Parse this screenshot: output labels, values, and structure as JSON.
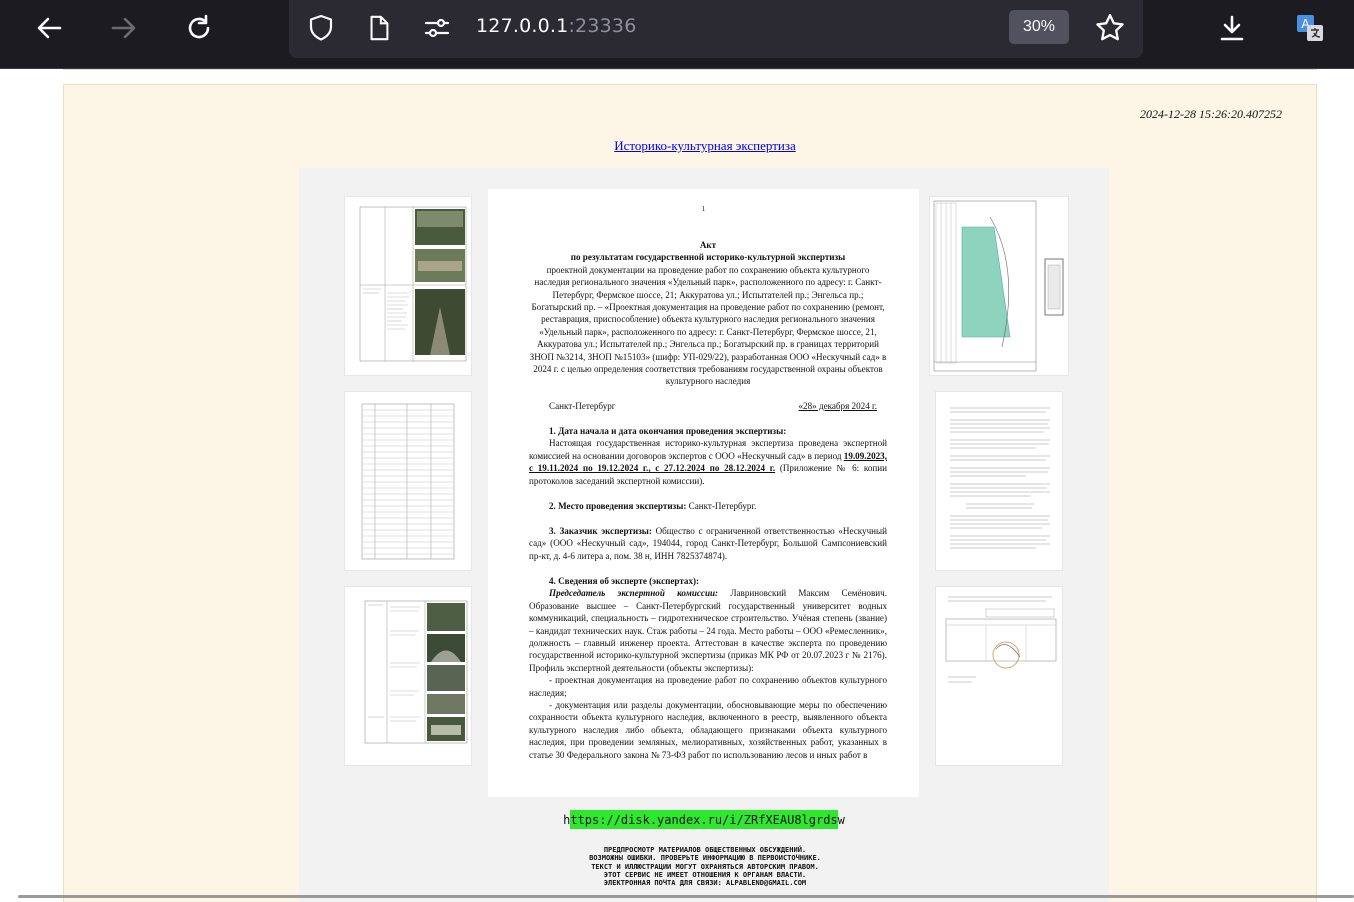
{
  "browser": {
    "url_host": "127.0.0.1",
    "url_port": ":23336",
    "zoom": "30%",
    "icons": [
      "back-arrow-icon",
      "forward-arrow-icon",
      "reload-icon",
      "shield-icon",
      "page-icon",
      "permissions-icon",
      "star-icon",
      "download-icon",
      "translate-icon"
    ]
  },
  "page": {
    "timestamp": "2024-12-28 15:26:20.407252",
    "link_text": "Историко-культурная экспертиза",
    "document": {
      "page_number": "1",
      "title": "Акт",
      "subtitle": "по результатам государственной историко-культурной экспертизы",
      "intro": "проектной документации на проведение работ по сохранению объекта культурного наследия регионального значения «Удельный парк», расположенного по адресу: г. Санкт-Петербург, Фермское шоссе, 21; Аккуратова ул.; Испытателей пр.; Энгельса пр.; Богатырский пр. – «Проектная документация на проведение работ по сохранению (ремонт, реставрация, приспособление) объекта культурного наследия регионального значения «Удельный парк», расположенного по адресу: г. Санкт-Петербург, Фермское шоссе, 21, Аккуратова ул.; Испытателей пр.; Энгельса пр.; Богатырский пр. в границах территорий ЗНОП №3214, ЗНОП №15103» (шифр: УП-029/22), разработанная ООО «Нескучный сад» в 2024 г. с целью определения соответствия требованиям государственной охраны объектов культурного наследия",
      "city": "Санкт-Петербург",
      "date": "«28» декабря 2024 г.",
      "s1_heading": "1. Дата начала и дата окончания проведения экспертизы:",
      "s1_text_a": "Настоящая государственная историко-культурная экспертиза проведена экспертной комиссией на основании договоров экспертов с ООО «Нескучный сад» в период",
      "s1_dates": "19.09.2023, с 19.11.2024 по 19.12.2024 г., с 27.12.2024 по 28.12.2024 г.",
      "s1_text_b": "(Приложение № 6: копии протоколов заседаний экспертной комиссии).",
      "s2_heading": "2. Место проведения экспертизы:",
      "s2_text": "Санкт-Петербург.",
      "s3_heading": "3. Заказчик экспертизы:",
      "s3_text": "Общество с ограниченной ответственностью «Нескучный сад» (ООО «Нескучный сад», 194044, город Санкт-Петербург, Большой Сампсониевский пр-кт, д. 4-6 литера а, пом. 38 н, ИНН 7825374874).",
      "s4_heading": "4. Сведения об эксперте (экспертах):",
      "s4_role": "Председатель экспертной комиссии:",
      "s4_text": "Лавриновский Максим Семёнович. Образование высшее – Санкт-Петербургский государственный университет водных коммуникаций, специальность – гидротехническое строительство. Учёная степень (звание) – кандидат технических наук. Стаж работы – 24 года. Место работы – ООО «Ремесленник», должность – главный инженер проекта. Аттестован в качестве эксперта по проведению государственной историко-культурной экспертизы (приказ МК РФ от 20.07.2023 г № 2176). Профиль экспертной деятельности (объекты экспертизы):",
      "s4_item1": "- проектная документация на проведение работ по сохранению объектов культурного наследия;",
      "s4_item2": "- документация или разделы документации, обосновывающие меры по обеспечению сохранности объекта культурного наследия, включенного в реестр, выявленного объекта культурного наследия либо объекта, обладающего признаками объекта культурного наследия, при проведении земляных, мелиоративных, хозяйственных работ, указанных в статье 30 Федерального закона № 73-ФЗ работ по использованию лесов и иных работ в"
    },
    "yandex_link": "https://disk.yandex.ru/i/ZRfXEAU8lgrdsw",
    "disclaimer": [
      "ПРЕДПРОСМОТР МАТЕРИАЛОВ ОБЩЕСТВЕННЫХ ОБСУЖДЕНИЙ.",
      "ВОЗМОЖНЫ ОШИБКИ. ПРОВЕРЬТЕ ИНФОРМАЦИЮ В ПЕРВОИСТОЧНИКЕ.",
      "ТЕКСТ И ИЛЛЮСТРАЦИИ МОГУТ ОХРАНЯТЬСЯ АВТОРСКИМ ПРАВОМ.",
      "ЭТОТ СЕРВИС НЕ ИМЕЕТ ОТНОШЕНИЯ К ОРГАНАМ ВЛАСТИ.",
      "ЭЛЕКТРОННАЯ ПОЧТА ДЛЯ СВЯЗИ: ALPABLEND@GMAIL.COM"
    ]
  }
}
